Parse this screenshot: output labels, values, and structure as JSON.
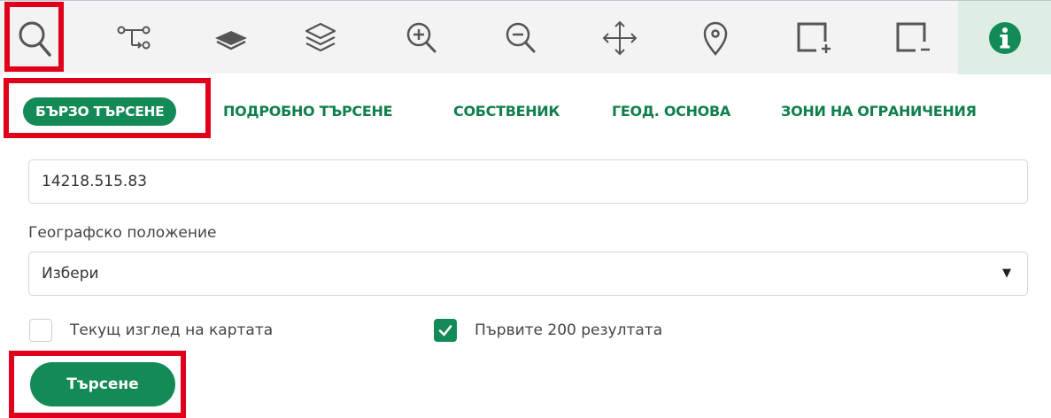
{
  "toolbar": {
    "tools": [
      {
        "name": "search-icon",
        "highlighted": true
      },
      {
        "name": "route-icon"
      },
      {
        "name": "layer-filled-icon"
      },
      {
        "name": "layers-outline-icon"
      },
      {
        "name": "zoom-in-icon"
      },
      {
        "name": "zoom-out-icon"
      },
      {
        "name": "pan-move-icon"
      },
      {
        "name": "location-pin-icon"
      },
      {
        "name": "select-add-icon"
      },
      {
        "name": "select-remove-icon"
      },
      {
        "name": "info-icon",
        "active": true
      }
    ]
  },
  "tabs": [
    {
      "label": "БЪРЗО ТЪРСЕНЕ",
      "active": true
    },
    {
      "label": "ПОДРОБНО ТЪРСЕНЕ"
    },
    {
      "label": "СОБСТВЕНИК"
    },
    {
      "label": "ГЕОД. ОСНОВА"
    },
    {
      "label": "ЗОНИ НА ОГРАНИЧЕНИЯ"
    }
  ],
  "form": {
    "query_value": "14218.515.83",
    "location_label": "Географско положение",
    "location_selected": "Избери",
    "current_view_label": "Текущ изглед на картата",
    "current_view_checked": false,
    "first200_label": "Първите 200 резултата",
    "first200_checked": true,
    "search_button": "Търсене"
  },
  "colors": {
    "accent": "#148a56",
    "highlight": "#e0001b",
    "toolbar_bg": "#f3f3f3",
    "info_bg": "#dfeee5"
  }
}
